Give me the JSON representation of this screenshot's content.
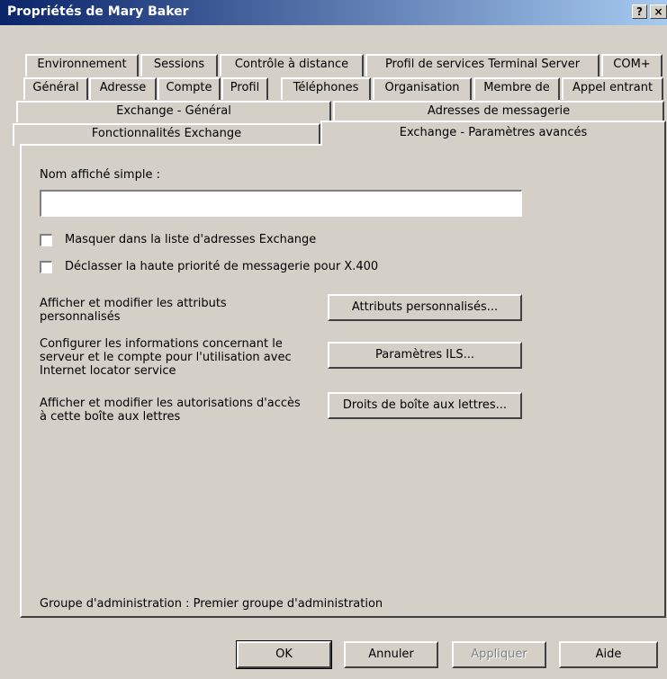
{
  "window": {
    "title": "Propriétés de Mary Baker",
    "help_glyph": "?",
    "close_glyph": "×"
  },
  "tabs": {
    "row1": [
      "Environnement",
      "Sessions",
      "Contrôle à distance",
      "Profil de services Terminal Server",
      "COM+"
    ],
    "row2": [
      "Général",
      "Adresse",
      "Compte",
      "Profil",
      "Téléphones",
      "Organisation",
      "Membre de",
      "Appel entrant"
    ],
    "row3": [
      "Exchange - Général",
      "Adresses de messagerie"
    ],
    "row4": [
      "Fonctionnalités Exchange",
      "Exchange - Paramètres avancés"
    ]
  },
  "form": {
    "simple_name_label": "Nom affiché simple :",
    "simple_name_value": "",
    "hide_checkbox_label": "Masquer dans la liste d'adresses Exchange",
    "downgrade_checkbox_label": "Déclasser la haute priorité de messagerie pour X.400",
    "custom_attr_desc": "Afficher et modifier les attributs personnalisés",
    "custom_attr_button": "Attributs personnalisés...",
    "ils_desc": "Configurer les informations concernant le serveur et le compte pour l'utilisation avec Internet locator service",
    "ils_button": "Paramètres ILS...",
    "mailbox_rights_desc": "Afficher et modifier les autorisations d'accès à cette boîte aux lettres",
    "mailbox_rights_button": "Droits de boîte aux lettres...",
    "admin_group": "Groupe d'administration : Premier groupe d'administration"
  },
  "footer": {
    "ok": "OK",
    "cancel": "Annuler",
    "apply": "Appliquer",
    "help": "Aide"
  }
}
